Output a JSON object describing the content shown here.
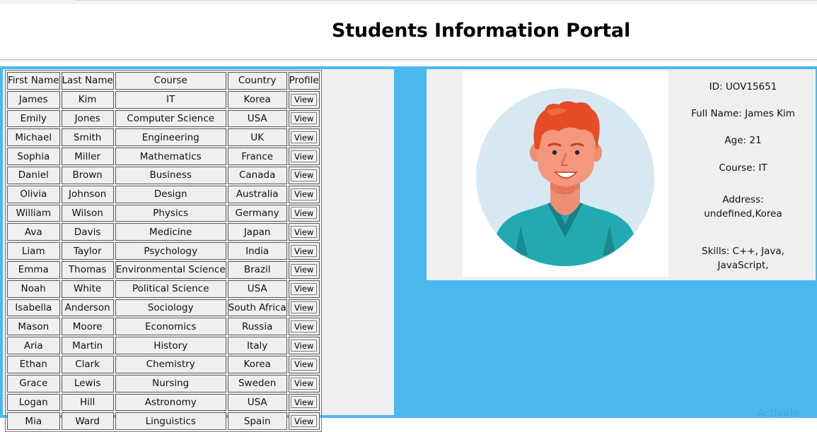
{
  "page_title": "Students Information Portal",
  "table": {
    "headers": [
      "First Name",
      "Last Name",
      "Course",
      "Country",
      "Profile"
    ],
    "rows": [
      [
        "James",
        "Kim",
        "IT",
        "Korea",
        "View"
      ],
      [
        "Emily",
        "Jones",
        "Computer Science",
        "USA",
        "View"
      ],
      [
        "Michael",
        "Smith",
        "Engineering",
        "UK",
        "View"
      ],
      [
        "Sophia",
        "Miller",
        "Mathematics",
        "France",
        "View"
      ],
      [
        "Daniel",
        "Brown",
        "Business",
        "Canada",
        "View"
      ],
      [
        "Olivia",
        "Johnson",
        "Design",
        "Australia",
        "View"
      ],
      [
        "William",
        "Wilson",
        "Physics",
        "Germany",
        "View"
      ],
      [
        "Ava",
        "Davis",
        "Medicine",
        "Japan",
        "View"
      ],
      [
        "Liam",
        "Taylor",
        "Psychology",
        "India",
        "View"
      ],
      [
        "Emma",
        "Thomas",
        "Environmental Science",
        "Brazil",
        "View"
      ],
      [
        "Noah",
        "White",
        "Political Science",
        "USA",
        "View"
      ],
      [
        "Isabella",
        "Anderson",
        "Sociology",
        "South Africa",
        "View"
      ],
      [
        "Mason",
        "Moore",
        "Economics",
        "Russia",
        "View"
      ],
      [
        "Aria",
        "Martin",
        "History",
        "Italy",
        "View"
      ],
      [
        "Ethan",
        "Clark",
        "Chemistry",
        "Korea",
        "View"
      ],
      [
        "Grace",
        "Lewis",
        "Nursing",
        "Sweden",
        "View"
      ],
      [
        "Logan",
        "Hill",
        "Astronomy",
        "USA",
        "View"
      ],
      [
        "Mia",
        "Ward",
        "Linguistics",
        "Spain",
        "View"
      ]
    ]
  },
  "profile": {
    "id": "ID: UOV15651",
    "full_name": "Full Name: James Kim",
    "age": "Age: 21",
    "course": "Course: IT",
    "address_label": "Address:",
    "address_value": "undefined,Korea",
    "skills_line1": "Skills: C++, Java,",
    "skills_line2": "JavaScript,"
  },
  "watermark": "Activate",
  "colors": {
    "background_blue": "#4ab8ee",
    "panel_gray": "#efefef"
  },
  "icons": {
    "avatar": "student-avatar-illustration"
  }
}
